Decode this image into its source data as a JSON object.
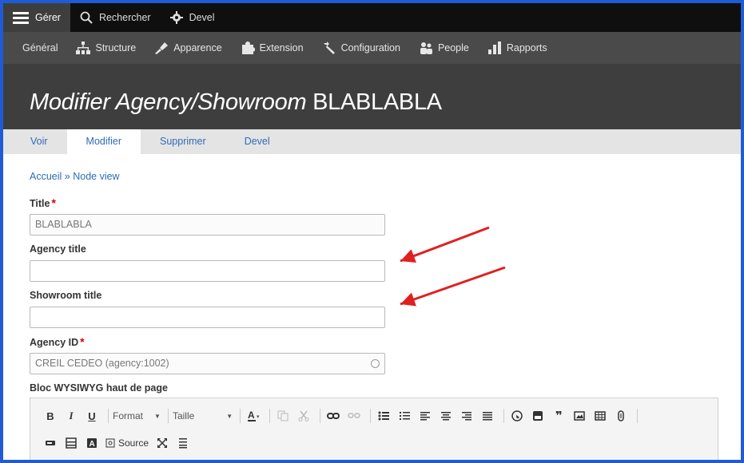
{
  "toolbar": {
    "items": [
      {
        "label": "Gérer",
        "icon": "hamburger-icon"
      },
      {
        "label": "Rechercher",
        "icon": "search-icon"
      },
      {
        "label": "Devel",
        "icon": "gear-icon"
      }
    ]
  },
  "tray": {
    "items": [
      {
        "label": "Général"
      },
      {
        "label": "Structure",
        "icon": "structure-icon"
      },
      {
        "label": "Apparence",
        "icon": "paintbrush-icon"
      },
      {
        "label": "Extension",
        "icon": "puzzle-icon"
      },
      {
        "label": "Configuration",
        "icon": "wrench-icon"
      },
      {
        "label": "People",
        "icon": "people-icon"
      },
      {
        "label": "Rapports",
        "icon": "bar-chart-icon"
      }
    ]
  },
  "page": {
    "title_italic": "Modifier Agency/Showroom",
    "title_rest": "BLABLABLA"
  },
  "tabs": [
    "Voir",
    "Modifier",
    "Supprimer",
    "Devel"
  ],
  "breadcrumb": {
    "home": "Accueil",
    "sep": "»",
    "current": "Node view"
  },
  "form": {
    "title": {
      "label": "Title",
      "required": "*",
      "value": "BLABLABLA"
    },
    "agency_title": {
      "label": "Agency title",
      "value": ""
    },
    "showroom_title": {
      "label": "Showroom title",
      "value": ""
    },
    "agency_id": {
      "label": "Agency ID",
      "required": "*",
      "value": "CREIL CEDEO (agency:1002)"
    },
    "wysiwyg": {
      "label": "Bloc WYSIWYG haut de page"
    }
  },
  "editor": {
    "bold": "B",
    "italic": "I",
    "underline": "U",
    "format": "Format",
    "size": "Taille",
    "source": "Source"
  },
  "colors": {
    "toolbar_bg": "#0f0f0f",
    "tray_bg": "#4a4a4a",
    "header_bg": "#3e3e3e",
    "link": "#2d6bb8",
    "required": "#d70000",
    "annotation_arrow": "#e02020",
    "frame_border": "#1f5bd6"
  }
}
